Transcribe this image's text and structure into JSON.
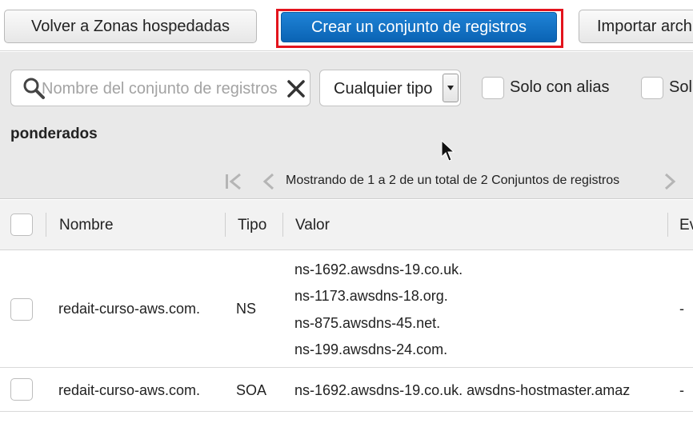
{
  "toolbar": {
    "back_label": "Volver a Zonas hospedadas",
    "create_label": "Crear un conjunto de registros",
    "import_label": "Importar arch"
  },
  "filters": {
    "search_placeholder": "Nombre del conjunto de registros",
    "type_select_value": "Cualquier tipo",
    "alias_only_label": "Solo con alias",
    "weighted_label_start": "Sol",
    "weighted_label_end": "ponderados"
  },
  "pagination": {
    "status_text": "Mostrando de 1 a 2 de un total de 2 Conjuntos de registros"
  },
  "table": {
    "columns": [
      "Nombre",
      "Tipo",
      "Valor",
      "Ev"
    ],
    "rows": [
      {
        "name": "redait-curso-aws.com.",
        "type": "NS",
        "values": [
          "ns-1692.awsdns-19.co.uk.",
          "ns-1173.awsdns-18.org.",
          "ns-875.awsdns-45.net.",
          "ns-199.awsdns-24.com."
        ],
        "eval": "-"
      },
      {
        "name": "redait-curso-aws.com.",
        "type": "SOA",
        "values": [
          "ns-1692.awsdns-19.co.uk. awsdns-hostmaster.amaz"
        ],
        "eval": "-"
      }
    ]
  },
  "colors": {
    "primary_button": "#1072c6",
    "highlight_border": "#e3141d",
    "filter_bg": "#e9e9e9"
  },
  "icons": [
    "search-icon",
    "clear-icon",
    "chevron-down-icon",
    "first-page-icon",
    "prev-page-icon",
    "next-page-icon",
    "mouse-cursor-icon"
  ]
}
